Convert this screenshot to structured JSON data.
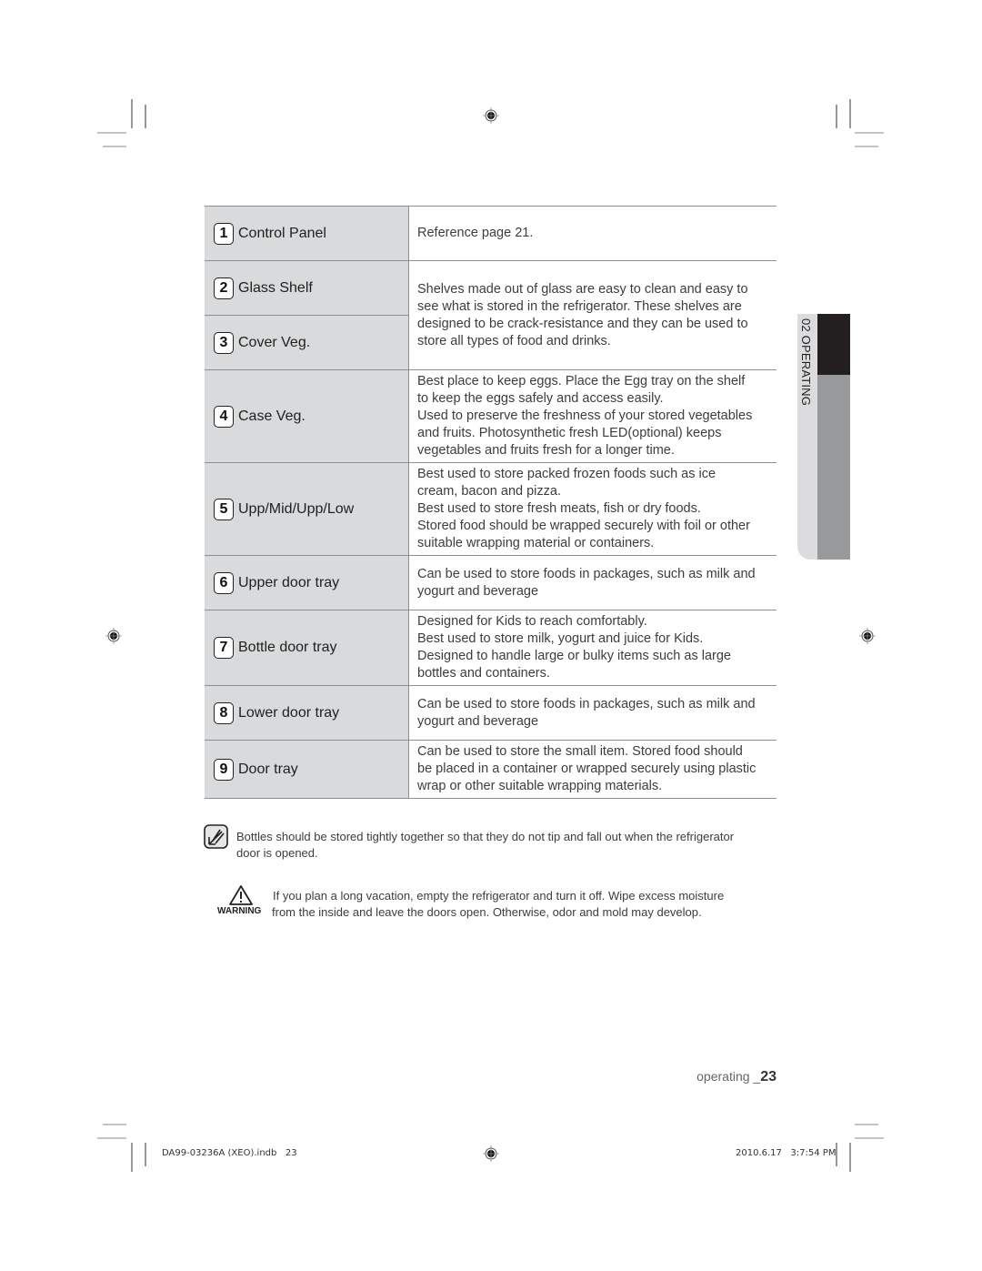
{
  "side_tab": {
    "label": "02 OPERATING"
  },
  "parts": [
    {
      "number": "1",
      "name": "Control Panel",
      "description": [
        "Reference page 21."
      ]
    },
    {
      "number": "2",
      "name": "Glass Shelf",
      "description": [
        "Shelves made out of glass are easy to clean and easy to",
        "see what is stored in the refrigerator. These shelves are",
        "designed to be crack-resistance and they can be used to",
        "store all types of food and drinks."
      ]
    },
    {
      "number": "3",
      "name": "Cover Veg.",
      "description": []
    },
    {
      "number": "4",
      "name": "Case Veg.",
      "description": [
        "Best place to keep eggs. Place the Egg tray on the shelf",
        "to keep the eggs safely and access easily.",
        "Used to preserve the freshness of your stored vegetables",
        "and fruits. Photosynthetic fresh LED(optional) keeps",
        "vegetables and fruits fresh for a longer time."
      ]
    },
    {
      "number": "5",
      "name": "Upp/Mid/Upp/Low",
      "description": [
        "Best used to store packed frozen foods such as ice",
        "cream, bacon and pizza.",
        "Best used to store fresh meats, fish or dry foods.",
        "Stored food should be wrapped securely with foil or other",
        "suitable wrapping material or containers."
      ]
    },
    {
      "number": "6",
      "name": "Upper door tray",
      "description": [
        "Can be used to store foods in packages, such as milk and",
        "yogurt and beverage"
      ]
    },
    {
      "number": "7",
      "name": "Bottle door tray",
      "description": [
        "Designed for Kids to reach comfortably.",
        "Best used to store milk, yogurt and juice for Kids.",
        "Designed to handle large or bulky items such as large",
        "bottles and containers."
      ]
    },
    {
      "number": "8",
      "name": "Lower door tray",
      "description": [
        "Can be used to store foods in packages, such as milk and",
        "yogurt and beverage"
      ]
    },
    {
      "number": "9",
      "name": "Door tray",
      "description": [
        "Can be used to store the small item. Stored food should",
        "be placed in a container or wrapped securely using plastic",
        "wrap or other suitable wrapping materials."
      ]
    }
  ],
  "note": {
    "icon": "note-pencil-icon",
    "lines": [
      "Bottles should be stored tightly together so that they do not tip and fall out when the refrigerator",
      "door is opened."
    ]
  },
  "warning": {
    "icon": "warning-triangle-icon",
    "label": "WARNING",
    "lines": [
      "If you plan a long vacation,  empty the refrigerator and turn it off. Wipe excess moisture",
      "from the inside and leave the doors open. Otherwise, odor and mold may develop."
    ]
  },
  "page_footer": {
    "section": "operating _",
    "page": "23"
  },
  "print_footer": {
    "file": "DA99-03236A (XEO).indb   23",
    "timestamp": "2010.6.17   3:7:54 PM"
  }
}
